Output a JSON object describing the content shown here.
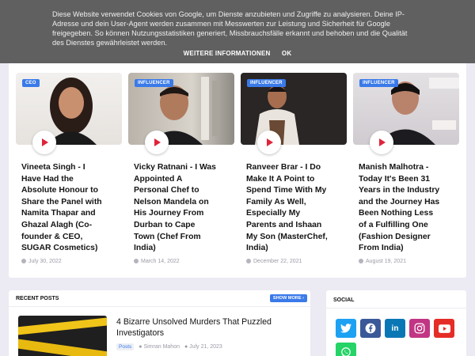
{
  "cookie": {
    "text": "Diese Website verwendet Cookies von Google, um Dienste anzubieten und Zugriffe zu analysieren. Deine IP-Adresse und dein User-Agent werden zusammen mit Messwerten zur Leistung und Sicherheit für Google freigegeben. So können Nutzungsstatistiken generiert, Missbrauchsfälle erkannt und behoben und die Qualität des Dienstes gewährleistet werden.",
    "more_info": "WEITERE INFORMATIONEN",
    "ok": "OK"
  },
  "featured": [
    {
      "badge": "CEO",
      "title": "Vineeta Singh - I Have Had the Absolute Honour to Share the Panel with Namita Thapar and Ghazal Alagh (Co-founder & CEO, SUGAR Cosmetics)",
      "date": "July 30, 2022",
      "thumb_color": "#ece9e6"
    },
    {
      "badge": "INFLUENCER",
      "title": "Vicky Ratnani - I Was Appointed A Personal Chef to Nelson Mandela on His Journey From Durban to Cape Town (Chef From India)",
      "date": "March 14, 2022",
      "thumb_color": "#c9c3bb"
    },
    {
      "badge": "INFLUENCER",
      "title": "Ranveer Brar - I Do Make It A Point to Spend Time With My Family As Well, Especially My Parents and Ishaan My Son (MasterChef, India)",
      "date": "December 22, 2021",
      "thumb_color": "#2a2626"
    },
    {
      "badge": "INFLUENCER",
      "title": "Manish Malhotra - Today It's Been 31 Years in the Industry and the Journey Has Been Nothing Less of a Fulfilling One (Fashion Designer From India)",
      "date": "August 19, 2021",
      "thumb_color": "#d9d6da"
    }
  ],
  "recent": {
    "heading": "RECENT POSTS",
    "show_more": "SHOW MORE ›",
    "post": {
      "title": "4 Bizarre Unsolved Murders That Puzzled Investigators",
      "tag": "Posts",
      "author": "Simran Mahon",
      "date": "July 21, 2023"
    }
  },
  "social": {
    "heading": "SOCIAL",
    "icons": [
      {
        "name": "twitter-icon",
        "color": "#1da1f2"
      },
      {
        "name": "facebook-icon",
        "color": "#3b5998"
      },
      {
        "name": "linkedin-icon",
        "color": "#0a77b5"
      },
      {
        "name": "instagram-icon",
        "color": "#c13584"
      },
      {
        "name": "youtube-icon",
        "color": "#e52d27"
      },
      {
        "name": "whatsapp-icon",
        "color": "#25d366"
      }
    ]
  }
}
